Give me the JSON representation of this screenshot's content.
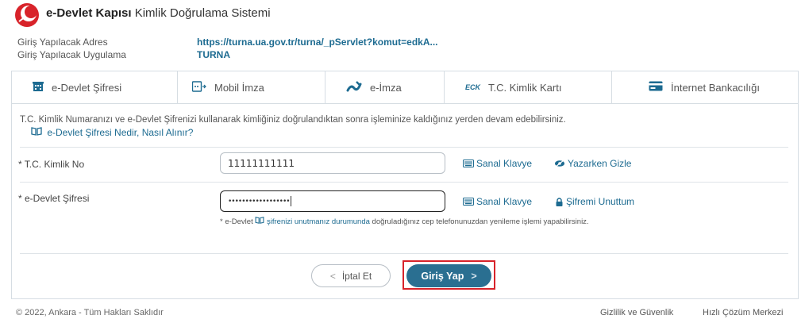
{
  "header": {
    "brand_bold": "e-Devlet Kapısı",
    "brand_rest": "Kimlik Doğrulama Sistemi",
    "logo_icon": "edevlet-crescent-logo"
  },
  "info": {
    "address_label": "Giriş Yapılacak Adres",
    "address_value": "https://turna.ua.gov.tr/turna/_pServlet?komut=edkA...",
    "app_label": "Giriş Yapılacak Uygulama",
    "app_value": "TURNA"
  },
  "tabs": [
    {
      "label": "e-Devlet Şifresi",
      "icon": "building-icon",
      "active": true
    },
    {
      "label": "Mobil İmza",
      "icon": "mobile-signature-icon",
      "active": false
    },
    {
      "label": "e-İmza",
      "icon": "pen-signature-icon",
      "active": false
    },
    {
      "label": "T.C. Kimlik Kartı",
      "icon": "id-card-icon",
      "active": false
    },
    {
      "label": "İnternet Bankacılığı",
      "icon": "credit-card-icon",
      "active": false
    }
  ],
  "form": {
    "description": "T.C. Kimlik Numaranızı ve e-Devlet Şifrenizi kullanarak kimliğiniz doğrulandıktan sonra işleminize kaldığınız yerden devam edebilirsiniz.",
    "help_link": "e-Devlet Şifresi Nedir, Nasıl Alınır?",
    "tc_label": "* T.C. Kimlik No",
    "tc_value": "11111111111",
    "password_label": "* e-Devlet Şifresi",
    "password_value": "••••••••••••••••••",
    "virtual_keyboard": "Sanal Klavye",
    "hide_while_typing": "Yazarken Gizle",
    "forgot_password": "Şifremi Unuttum",
    "note_prefix": "* e-Devlet",
    "note_link": "şifrenizi unutmanız durumunda",
    "note_suffix": "doğruladığınız cep telefonunuzdan yenileme işlemi yapabilirsiniz."
  },
  "buttons": {
    "cancel": "İptal Et",
    "login": "Giriş Yap"
  },
  "footer": {
    "copyright": "© 2022, Ankara - Tüm Hakları Saklıdır",
    "privacy": "Gizlilik ve Güvenlik",
    "support": "Hızlı Çözüm Merkezi"
  },
  "colors": {
    "accent": "#2a6f91",
    "link": "#1d6b91",
    "highlight": "#d8232a",
    "logo": "#d8232a"
  }
}
